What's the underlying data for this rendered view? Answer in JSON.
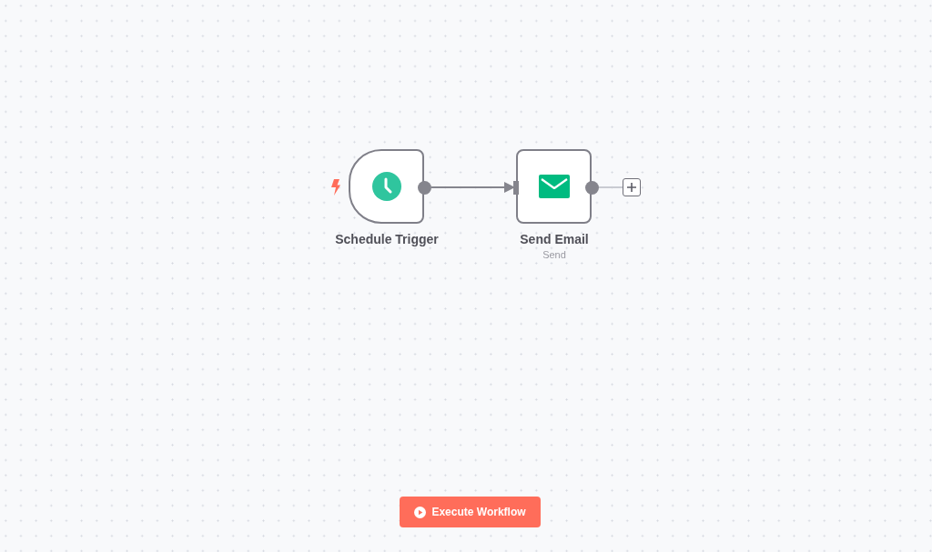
{
  "canvas": {
    "nodes": [
      {
        "kind": "trigger",
        "name": "Schedule Trigger"
      },
      {
        "kind": "action",
        "name": "Send Email",
        "subtitle": "Send"
      }
    ]
  },
  "execute_button": {
    "label": "Execute Workflow"
  }
}
